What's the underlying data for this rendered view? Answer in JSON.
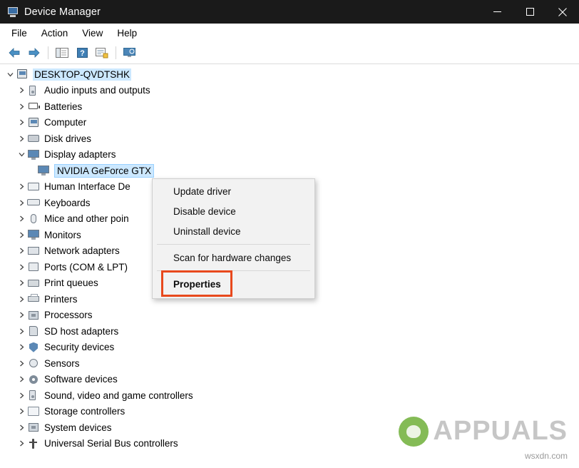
{
  "window": {
    "title": "Device Manager",
    "minimize_label": "Minimize",
    "maximize_label": "Maximize",
    "close_label": "Close"
  },
  "menubar": {
    "items": [
      {
        "label": "File"
      },
      {
        "label": "Action"
      },
      {
        "label": "View"
      },
      {
        "label": "Help"
      }
    ]
  },
  "toolbar": {
    "buttons": [
      {
        "name": "back-button",
        "icon": "arrow-left-icon"
      },
      {
        "name": "forward-button",
        "icon": "arrow-right-icon"
      },
      {
        "name": "show-hide-console-tree-button",
        "icon": "console-tree-icon"
      },
      {
        "name": "help-button",
        "icon": "question-mark-icon"
      },
      {
        "name": "properties-button",
        "icon": "properties-icon"
      },
      {
        "name": "scan-hardware-changes-button",
        "icon": "scan-monitor-icon"
      }
    ]
  },
  "tree": {
    "root": {
      "label": "DESKTOP-QVDTSHK",
      "icon": "computer-icon",
      "expanded": true
    },
    "nodes": [
      {
        "label": "Audio inputs and outputs",
        "icon": "speaker-icon",
        "expanded": false
      },
      {
        "label": "Batteries",
        "icon": "battery-icon",
        "expanded": false
      },
      {
        "label": "Computer",
        "icon": "computer-icon",
        "expanded": false
      },
      {
        "label": "Disk drives",
        "icon": "disk-drive-icon",
        "expanded": false
      },
      {
        "label": "Display adapters",
        "icon": "display-adapter-icon",
        "expanded": true
      },
      {
        "label": "Human Interface De",
        "icon": "hid-icon",
        "expanded": false
      },
      {
        "label": "Keyboards",
        "icon": "keyboard-icon",
        "expanded": false
      },
      {
        "label": "Mice and other poin",
        "icon": "mouse-icon",
        "expanded": false
      },
      {
        "label": "Monitors",
        "icon": "monitor-icon",
        "expanded": false
      },
      {
        "label": "Network adapters",
        "icon": "network-adapter-icon",
        "expanded": false
      },
      {
        "label": "Ports (COM & LPT)",
        "icon": "port-icon",
        "expanded": false
      },
      {
        "label": "Print queues",
        "icon": "print-queue-icon",
        "expanded": false
      },
      {
        "label": "Printers",
        "icon": "printer-icon",
        "expanded": false
      },
      {
        "label": "Processors",
        "icon": "processor-icon",
        "expanded": false
      },
      {
        "label": "SD host adapters",
        "icon": "sd-card-icon",
        "expanded": false
      },
      {
        "label": "Security devices",
        "icon": "shield-icon",
        "expanded": false
      },
      {
        "label": "Sensors",
        "icon": "sensor-icon",
        "expanded": false
      },
      {
        "label": "Software devices",
        "icon": "gear-icon",
        "expanded": false
      },
      {
        "label": "Sound, video and game controllers",
        "icon": "speaker-icon",
        "expanded": false
      },
      {
        "label": "Storage controllers",
        "icon": "storage-controller-icon",
        "expanded": false
      },
      {
        "label": "System devices",
        "icon": "system-device-icon",
        "expanded": false
      },
      {
        "label": "Universal Serial Bus controllers",
        "icon": "usb-icon",
        "expanded": false
      }
    ],
    "selected_device": {
      "label": "NVIDIA GeForce GTX",
      "icon": "display-adapter-icon"
    }
  },
  "context_menu": {
    "items": [
      {
        "label": "Update driver"
      },
      {
        "label": "Disable device"
      },
      {
        "label": "Uninstall device"
      },
      {
        "separator": true
      },
      {
        "label": "Scan for hardware changes"
      },
      {
        "separator": true
      },
      {
        "label": "Properties",
        "bold": true,
        "highlighted": true
      }
    ],
    "highlight_color": "#e8491d"
  },
  "watermark": {
    "brand": "APPUALS",
    "url": "wsxdn.com"
  }
}
